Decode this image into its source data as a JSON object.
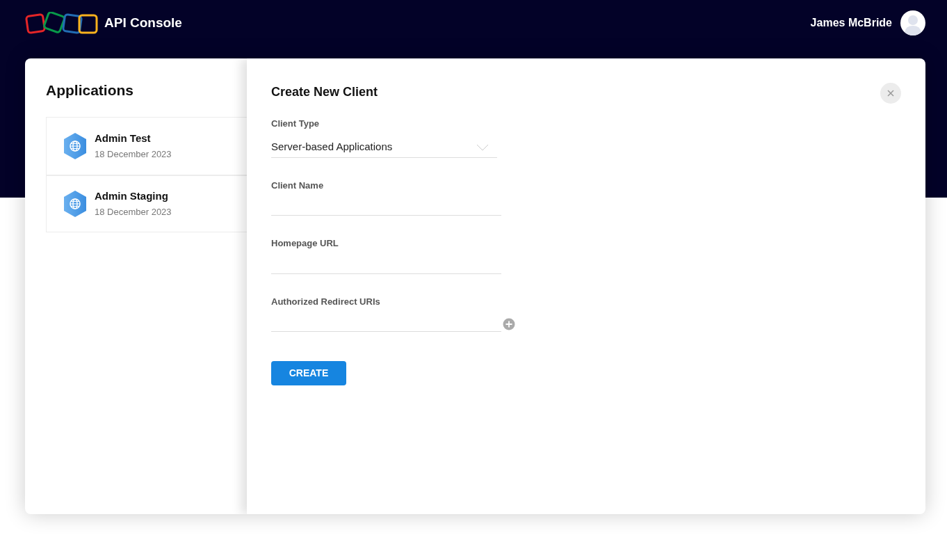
{
  "header": {
    "title": "API Console",
    "user_name": "James McBride"
  },
  "applications": {
    "title": "Applications",
    "items": [
      {
        "name": "Admin Test",
        "date": "18 December 2023"
      },
      {
        "name": "Admin Staging",
        "date": "18 December 2023"
      }
    ]
  },
  "dialog": {
    "title": "Create New Client",
    "fields": [
      {
        "kind": "select",
        "label": "Client Type",
        "value": "Server-based Applications"
      },
      {
        "kind": "text",
        "label": "Client Name"
      },
      {
        "kind": "text",
        "label": "Homepage URL"
      },
      {
        "kind": "multi",
        "label": "Authorized Redirect URIs"
      }
    ],
    "submit": "CREATE"
  }
}
